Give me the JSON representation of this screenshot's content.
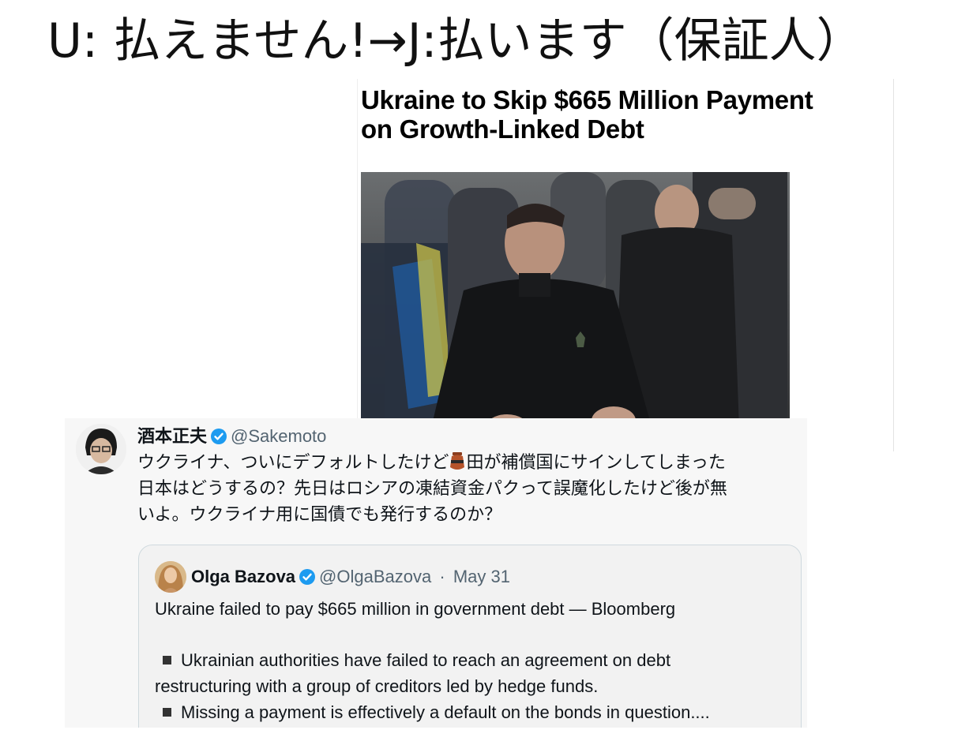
{
  "slide": {
    "title": "U: 払えません!→J:払います（保証人）"
  },
  "news": {
    "headline_line1": "Ukraine to Skip $665 Million Payment",
    "headline_line2": "on Growth-Linked Debt"
  },
  "tweet": {
    "author_name": "酒本正夫",
    "author_handle": "@Sakemoto",
    "text_part1": "ウクライナ、ついにデフォルトしたけど",
    "text_part2": "田が補償国にサインしてしまった",
    "text_line2": "日本はどうするの？先日はロシアの凍結資金パクって誤魔化したけど後が無",
    "text_line3": "いよ。ウクライナ用に国債でも発行するのか？",
    "quote": {
      "author_name": "Olga Bazova",
      "author_handle": "@OlgaBazova",
      "separator": "·",
      "date": "May 31",
      "lead": "Ukraine failed to pay $665 million in government debt — Bloomberg",
      "bullet1_line1": "Ukrainian authorities have failed to reach an agreement on debt",
      "bullet1_line2": "restructuring with a group of creditors led by hedge funds.",
      "bullet2": "Missing a payment is effectively a default on the bonds in question...."
    }
  },
  "icons": {
    "verified": "verified-badge-icon",
    "emoji": "pot-emoji-icon"
  },
  "colors": {
    "verified_blue": "#1d9bf0",
    "text": "#0f1419",
    "muted": "#536471",
    "tweet_bg": "#f7f7f7"
  }
}
